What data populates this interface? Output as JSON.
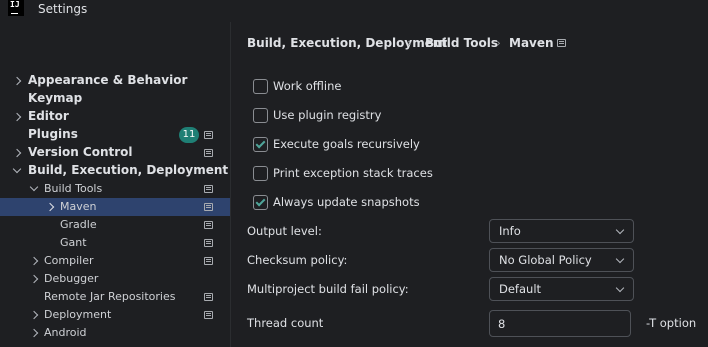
{
  "window": {
    "logo_text": "IJ",
    "title": "Settings"
  },
  "search": {
    "value": "",
    "placeholder": ""
  },
  "tree": [
    {
      "label": "Appearance & Behavior",
      "level": 0,
      "expander": "right",
      "bold": true
    },
    {
      "label": "Keymap",
      "level": 0,
      "expander": "none",
      "bold": true
    },
    {
      "label": "Editor",
      "level": 0,
      "expander": "right",
      "bold": true
    },
    {
      "label": "Plugins",
      "level": 0,
      "expander": "none",
      "bold": true,
      "badge": "11",
      "settings_icon": true
    },
    {
      "label": "Version Control",
      "level": 0,
      "expander": "right",
      "bold": true,
      "settings_icon": true
    },
    {
      "label": "Build, Execution, Deployment",
      "level": 0,
      "expander": "down",
      "bold": true
    },
    {
      "label": "Build Tools",
      "level": 1,
      "expander": "down",
      "settings_icon": true
    },
    {
      "label": "Maven",
      "level": 2,
      "expander": "right",
      "selected": true,
      "settings_icon": true
    },
    {
      "label": "Gradle",
      "level": 2,
      "expander": "none",
      "settings_icon": true
    },
    {
      "label": "Gant",
      "level": 2,
      "expander": "none",
      "settings_icon": true
    },
    {
      "label": "Compiler",
      "level": 1,
      "expander": "right",
      "settings_icon": true
    },
    {
      "label": "Debugger",
      "level": 1,
      "expander": "right"
    },
    {
      "label": "Remote Jar Repositories",
      "level": 1,
      "expander": "none",
      "settings_icon": true
    },
    {
      "label": "Deployment",
      "level": 1,
      "expander": "right",
      "settings_icon": true
    },
    {
      "label": "Android",
      "level": 1,
      "expander": "right"
    }
  ],
  "breadcrumb": {
    "items": [
      "Build, Execution, Deployment",
      "Build Tools",
      "Maven"
    ],
    "separator": "›"
  },
  "checkboxes": [
    {
      "label": "Work offline",
      "checked": false
    },
    {
      "label": "Use plugin registry",
      "checked": false
    },
    {
      "label": "Execute goals recursively",
      "checked": true
    },
    {
      "label": "Print exception stack traces",
      "checked": false
    },
    {
      "label": "Always update snapshots",
      "checked": true
    }
  ],
  "fields": {
    "output_level": {
      "label": "Output level:",
      "value": "Info"
    },
    "checksum_policy": {
      "label": "Checksum policy:",
      "value": "No Global Policy"
    },
    "multiproject_fail_policy": {
      "label": "Multiproject build fail policy:",
      "value": "Default"
    },
    "thread_count": {
      "label": "Thread count",
      "value": "8",
      "suffix": "-T option"
    }
  },
  "colors": {
    "background": "#1e1f22",
    "selection": "#2e436e",
    "badge": "#1f7f75",
    "checkmark": "#4fa59a",
    "text": "#dfe1e5"
  }
}
